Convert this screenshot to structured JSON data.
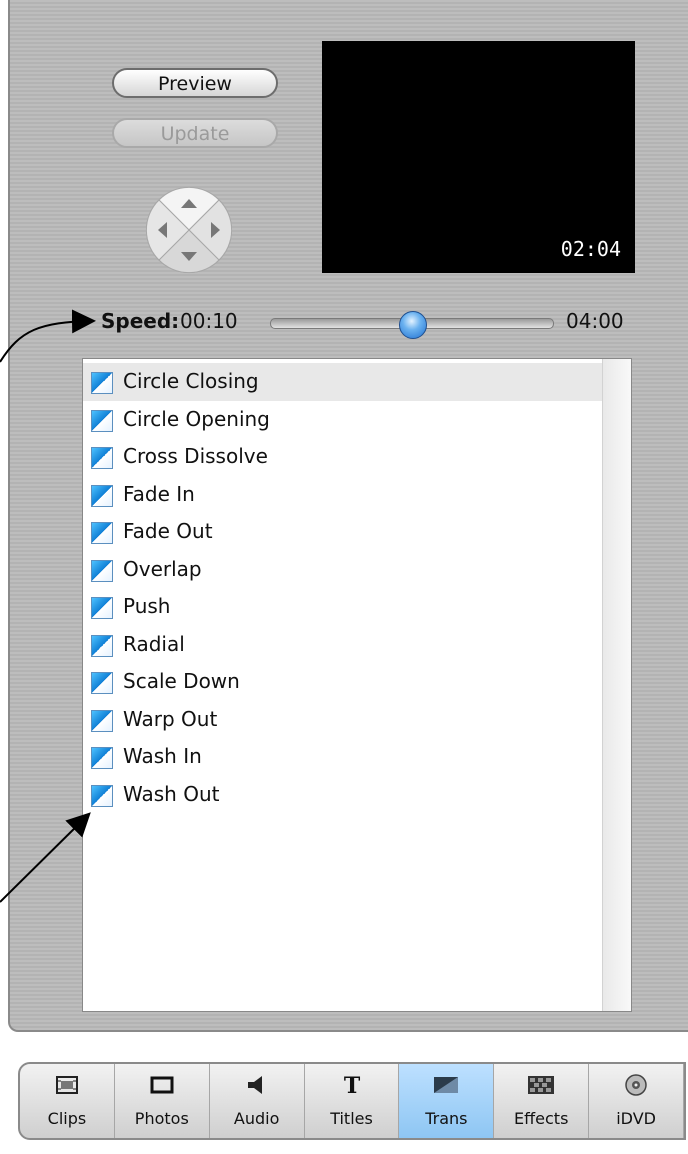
{
  "controls": {
    "preview_label": "Preview",
    "update_label": "Update"
  },
  "monitor": {
    "timecode": "02:04"
  },
  "speed": {
    "label": "Speed:",
    "min": "00:10",
    "max": "04:00",
    "position": 0.5
  },
  "transitions": {
    "selected_index": 0,
    "items": [
      "Circle Closing",
      "Circle Opening",
      "Cross Dissolve",
      "Fade In",
      "Fade Out",
      "Overlap",
      "Push",
      "Radial",
      "Scale Down",
      "Warp Out",
      "Wash In",
      "Wash Out"
    ]
  },
  "tabbar": {
    "active": "Trans",
    "tabs": [
      {
        "label": "Clips",
        "icon": "clips-icon"
      },
      {
        "label": "Photos",
        "icon": "photos-icon"
      },
      {
        "label": "Audio",
        "icon": "audio-icon"
      },
      {
        "label": "Titles",
        "icon": "titles-icon"
      },
      {
        "label": "Trans",
        "icon": "transitions-icon"
      },
      {
        "label": "Effects",
        "icon": "effects-icon"
      },
      {
        "label": "iDVD",
        "icon": "idvd-icon"
      }
    ]
  },
  "colors": {
    "accent": "#8ec6f3",
    "slider_knob": "#1f6fd0",
    "panel": "#b9b9b9"
  }
}
